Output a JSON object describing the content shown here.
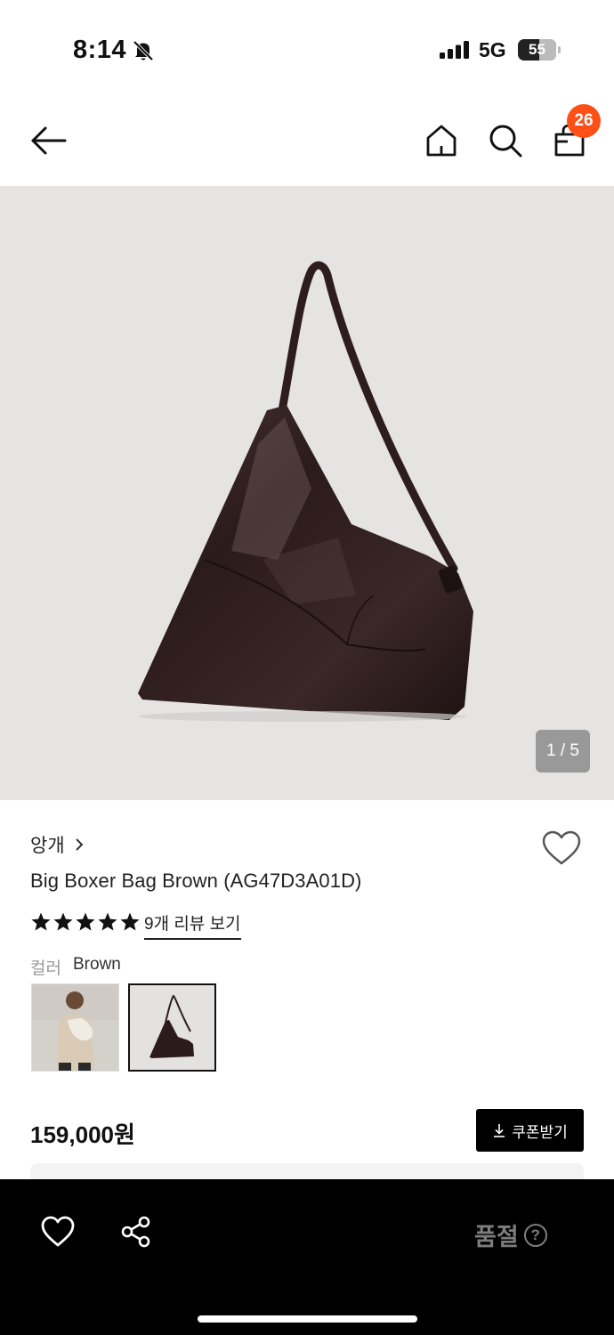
{
  "status_bar": {
    "time": "8:14",
    "network": "5G",
    "battery": "55"
  },
  "header": {
    "cart_count": "26",
    "icons": [
      "back-arrow-icon",
      "home-icon",
      "search-icon",
      "shopping-bag-icon"
    ]
  },
  "gallery": {
    "counter": "1 / 5"
  },
  "product": {
    "brand": "앙개",
    "title": "Big Boxer Bag Brown (AG47D3A01D)",
    "rating_stars": 5,
    "reviews_link": "9개 리뷰 보기",
    "color_label": "컬러",
    "color_value": "Brown",
    "price": "159,000원",
    "coupon_label": "쿠폰받기"
  },
  "bottom_bar": {
    "status": "품절",
    "help": "?"
  },
  "colors": {
    "badge": "#ff4f17",
    "hero_bg": "#e5e4e3",
    "bag": "#2a1a1a"
  }
}
